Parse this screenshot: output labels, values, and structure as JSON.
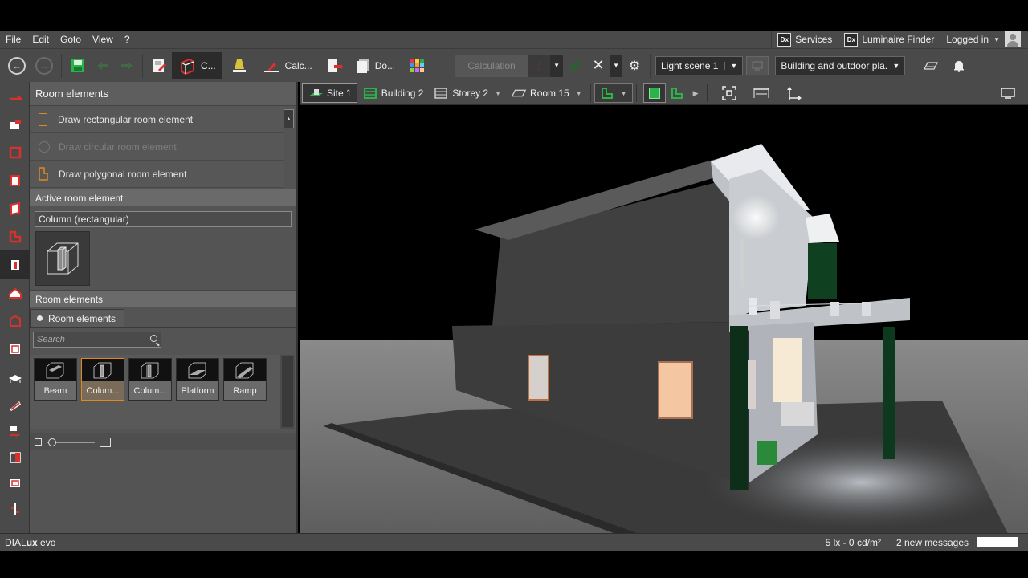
{
  "menubar": {
    "items": [
      "File",
      "Edit",
      "Goto",
      "View",
      "?"
    ],
    "services_label": "Services",
    "finder_label": "Luminaire Finder",
    "login_label": "Logged in",
    "dx_badge": "Dx"
  },
  "toolbar": {
    "construction_label": "C...",
    "calc_label": "Calc...",
    "doc_label": "Do...",
    "calculation_label": "Calculation",
    "light_scene": "Light scene 1",
    "view_mode": "Building and outdoor pla..."
  },
  "left_strip": {
    "icons": [
      "site-tool-icon",
      "building-tool-icon",
      "storey-tool-icon",
      "room-tool-icon",
      "wall-tool-icon",
      "polygon-tool-icon",
      "room-element-tool-icon",
      "roof-tool-icon",
      "furniture-tool-icon",
      "ceiling-tool-icon",
      "stairs-tool-icon",
      "ramp-tool-icon",
      "measure-tool-icon",
      "cut-tool-icon",
      "window-tool-icon",
      "align-tool-icon"
    ],
    "active_index": 6
  },
  "panel": {
    "title": "Room elements",
    "draw_items": [
      {
        "label": "Draw rectangular room element",
        "enabled": true
      },
      {
        "label": "Draw circular room element",
        "enabled": false
      },
      {
        "label": "Draw polygonal room element",
        "enabled": true
      }
    ],
    "active_section": "Active room element",
    "active_value": "Column (rectangular)",
    "catalog_section": "Room elements",
    "tab_label": "Room elements",
    "search_placeholder": "Search",
    "catalog": [
      {
        "label": "Beam",
        "selected": false
      },
      {
        "label": "Colum...",
        "selected": true
      },
      {
        "label": "Colum...",
        "selected": false
      },
      {
        "label": "Platform",
        "selected": false
      },
      {
        "label": "Ramp",
        "selected": false
      }
    ]
  },
  "navbar": {
    "crumbs": [
      {
        "label": "Site 1",
        "active": true,
        "dropdown": false
      },
      {
        "label": "Building 2",
        "active": false,
        "dropdown": false
      },
      {
        "label": "Storey 2",
        "active": false,
        "dropdown": true
      },
      {
        "label": "Room 15",
        "active": false,
        "dropdown": true
      }
    ]
  },
  "statusbar": {
    "brand_prefix": "DIAL",
    "brand_bold": "ux",
    "brand_suffix": " evo",
    "illuminance": "5 lx - 0 cd/m²",
    "messages": "2 new messages"
  },
  "colors": {
    "accent": "#e08a1e",
    "tool_red": "#d9302b",
    "green": "#2bb34a",
    "chrome": "#4a4a4a"
  }
}
